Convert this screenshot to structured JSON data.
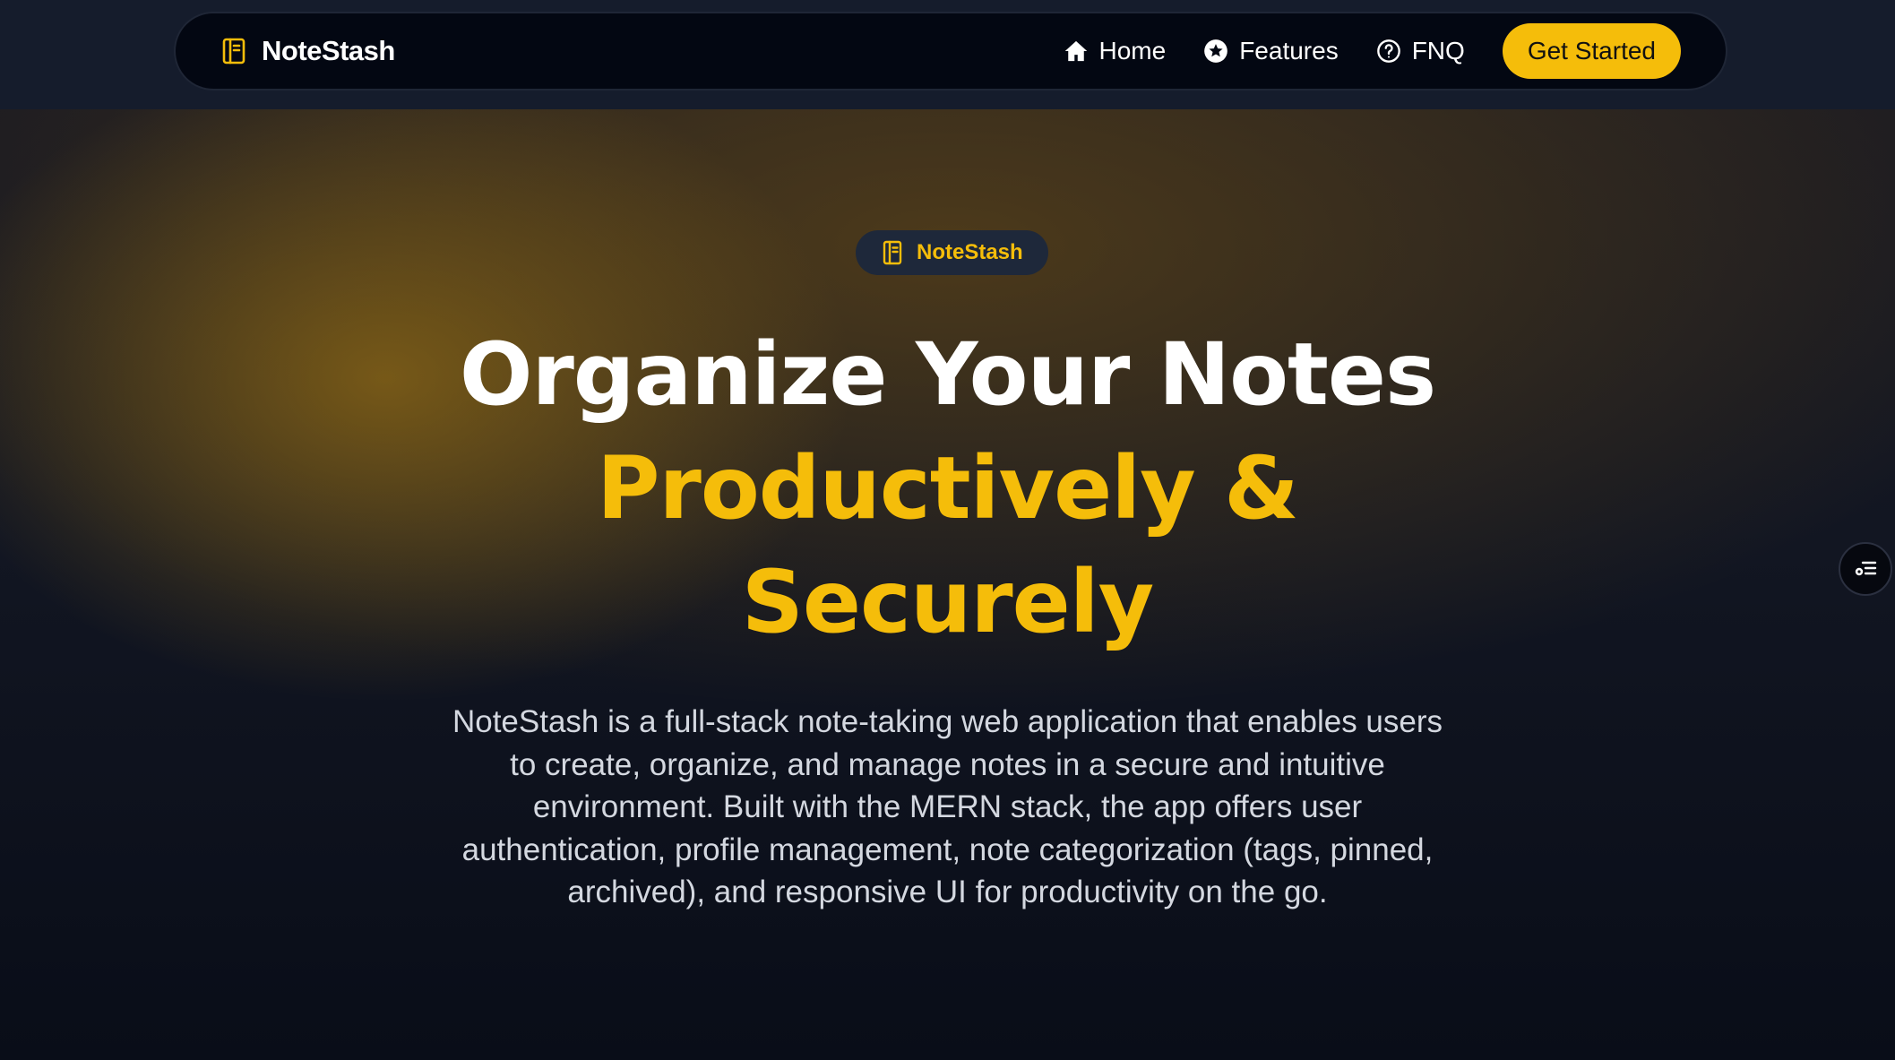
{
  "navbar": {
    "brand": {
      "icon": "notebook-icon",
      "name": "NoteStash"
    },
    "links": [
      {
        "icon": "home-icon",
        "label": "Home"
      },
      {
        "icon": "star-circle-icon",
        "label": "Features"
      },
      {
        "icon": "question-circle-icon",
        "label": "FNQ"
      }
    ],
    "cta_label": "Get Started"
  },
  "hero": {
    "badge": {
      "icon": "notebook-icon",
      "label": "NoteStash"
    },
    "title_line1": "Organize Your Notes",
    "title_line2": "Productively &",
    "title_line3": "Securely",
    "description": "NoteStash is a full-stack note-taking web application that enables users to create, organize, and manage notes in a secure and intuitive environment. Built with the MERN stack, the app offers user authentication, profile management, note categorization (tags, pinned, archived), and responsive UI for productivity on the go."
  },
  "floating_button": {
    "icon": "accessibility-menu-icon"
  },
  "colors": {
    "accent": "#f5bd0a",
    "navbar_bg": "#030712",
    "page_bg": "#0a0f1c",
    "badge_bg": "#1e283a"
  }
}
